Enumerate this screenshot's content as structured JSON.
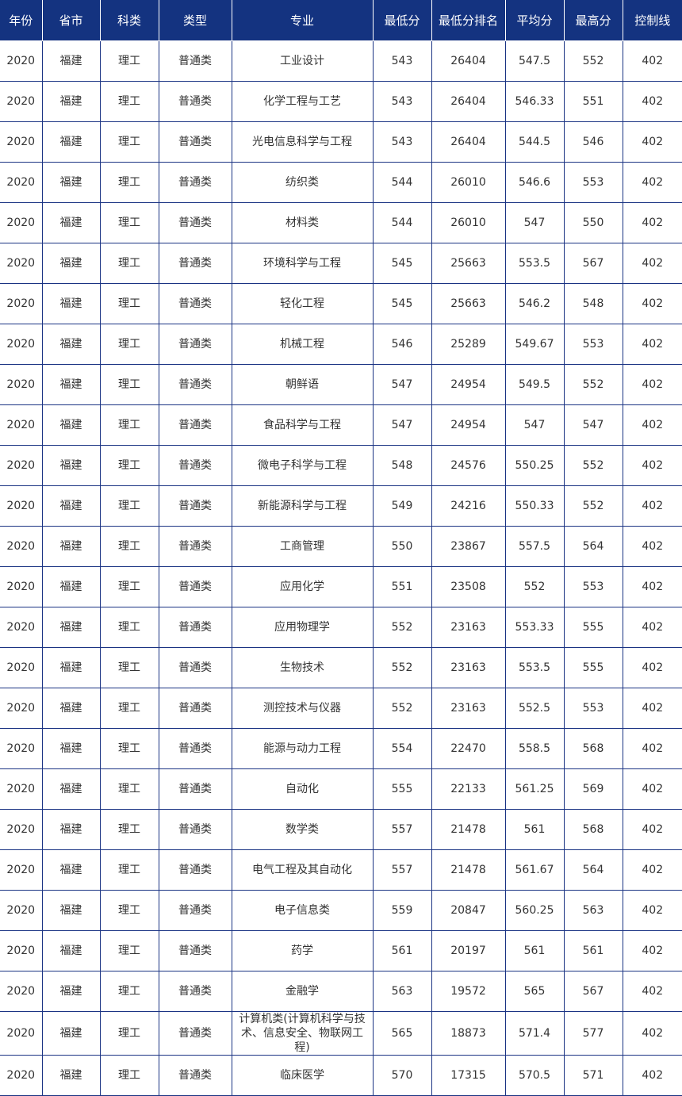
{
  "table": {
    "headers": [
      "年份",
      "省市",
      "科类",
      "类型",
      "专业",
      "最低分",
      "最低分排名",
      "平均分",
      "最高分",
      "控制线"
    ],
    "rows": [
      [
        "2020",
        "福建",
        "理工",
        "普通类",
        "工业设计",
        "543",
        "26404",
        "547.5",
        "552",
        "402"
      ],
      [
        "2020",
        "福建",
        "理工",
        "普通类",
        "化学工程与工艺",
        "543",
        "26404",
        "546.33",
        "551",
        "402"
      ],
      [
        "2020",
        "福建",
        "理工",
        "普通类",
        "光电信息科学与工程",
        "543",
        "26404",
        "544.5",
        "546",
        "402"
      ],
      [
        "2020",
        "福建",
        "理工",
        "普通类",
        "纺织类",
        "544",
        "26010",
        "546.6",
        "553",
        "402"
      ],
      [
        "2020",
        "福建",
        "理工",
        "普通类",
        "材料类",
        "544",
        "26010",
        "547",
        "550",
        "402"
      ],
      [
        "2020",
        "福建",
        "理工",
        "普通类",
        "环境科学与工程",
        "545",
        "25663",
        "553.5",
        "567",
        "402"
      ],
      [
        "2020",
        "福建",
        "理工",
        "普通类",
        "轻化工程",
        "545",
        "25663",
        "546.2",
        "548",
        "402"
      ],
      [
        "2020",
        "福建",
        "理工",
        "普通类",
        "机械工程",
        "546",
        "25289",
        "549.67",
        "553",
        "402"
      ],
      [
        "2020",
        "福建",
        "理工",
        "普通类",
        "朝鲜语",
        "547",
        "24954",
        "549.5",
        "552",
        "402"
      ],
      [
        "2020",
        "福建",
        "理工",
        "普通类",
        "食品科学与工程",
        "547",
        "24954",
        "547",
        "547",
        "402"
      ],
      [
        "2020",
        "福建",
        "理工",
        "普通类",
        "微电子科学与工程",
        "548",
        "24576",
        "550.25",
        "552",
        "402"
      ],
      [
        "2020",
        "福建",
        "理工",
        "普通类",
        "新能源科学与工程",
        "549",
        "24216",
        "550.33",
        "552",
        "402"
      ],
      [
        "2020",
        "福建",
        "理工",
        "普通类",
        "工商管理",
        "550",
        "23867",
        "557.5",
        "564",
        "402"
      ],
      [
        "2020",
        "福建",
        "理工",
        "普通类",
        "应用化学",
        "551",
        "23508",
        "552",
        "553",
        "402"
      ],
      [
        "2020",
        "福建",
        "理工",
        "普通类",
        "应用物理学",
        "552",
        "23163",
        "553.33",
        "555",
        "402"
      ],
      [
        "2020",
        "福建",
        "理工",
        "普通类",
        "生物技术",
        "552",
        "23163",
        "553.5",
        "555",
        "402"
      ],
      [
        "2020",
        "福建",
        "理工",
        "普通类",
        "测控技术与仪器",
        "552",
        "23163",
        "552.5",
        "553",
        "402"
      ],
      [
        "2020",
        "福建",
        "理工",
        "普通类",
        "能源与动力工程",
        "554",
        "22470",
        "558.5",
        "568",
        "402"
      ],
      [
        "2020",
        "福建",
        "理工",
        "普通类",
        "自动化",
        "555",
        "22133",
        "561.25",
        "569",
        "402"
      ],
      [
        "2020",
        "福建",
        "理工",
        "普通类",
        "数学类",
        "557",
        "21478",
        "561",
        "568",
        "402"
      ],
      [
        "2020",
        "福建",
        "理工",
        "普通类",
        "电气工程及其自动化",
        "557",
        "21478",
        "561.67",
        "564",
        "402"
      ],
      [
        "2020",
        "福建",
        "理工",
        "普通类",
        "电子信息类",
        "559",
        "20847",
        "560.25",
        "563",
        "402"
      ],
      [
        "2020",
        "福建",
        "理工",
        "普通类",
        "药学",
        "561",
        "20197",
        "561",
        "561",
        "402"
      ],
      [
        "2020",
        "福建",
        "理工",
        "普通类",
        "金融学",
        "563",
        "19572",
        "565",
        "567",
        "402"
      ],
      [
        "2020",
        "福建",
        "理工",
        "普通类",
        "计算机类(计算机科学与技术、信息安全、物联网工程)",
        "565",
        "18873",
        "571.4",
        "577",
        "402"
      ],
      [
        "2020",
        "福建",
        "理工",
        "普通类",
        "临床医学",
        "570",
        "17315",
        "570.5",
        "571",
        "402"
      ]
    ]
  },
  "colors": {
    "header_bg": "#143380",
    "border": "#1a3383",
    "header_text": "#ffffff",
    "cell_text": "#333333"
  }
}
